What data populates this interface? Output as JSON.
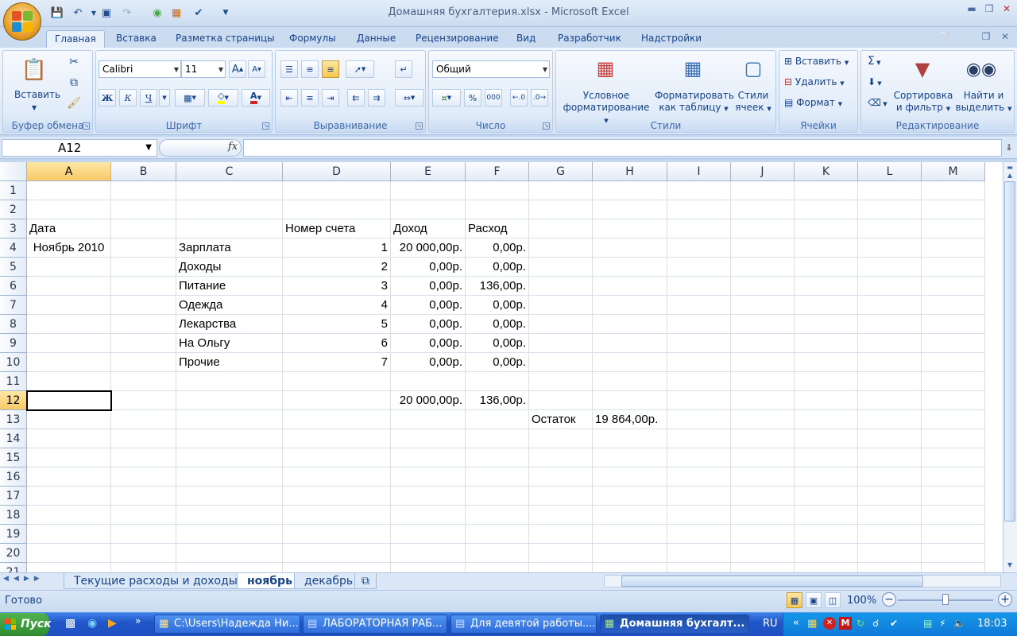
{
  "window": {
    "title": "Домашняя бухгалтерия.xlsx - Microsoft Excel"
  },
  "ribbon": {
    "tabs": [
      "Главная",
      "Вставка",
      "Разметка страницы",
      "Формулы",
      "Данные",
      "Рецензирование",
      "Вид",
      "Разработчик",
      "Надстройки"
    ],
    "active_tab": "Главная",
    "groups": {
      "clipboard": {
        "label": "Буфер обмена",
        "paste": "Вставить"
      },
      "font": {
        "label": "Шрифт",
        "font_name": "Calibri",
        "font_size": "11",
        "bold": "Ж",
        "italic": "К",
        "underline": "Ч",
        "grow": "A",
        "shrink": "A",
        "font_color_letter": "A"
      },
      "alignment": {
        "label": "Выравнивание"
      },
      "number": {
        "label": "Число",
        "format": "Общий",
        "percent": "%",
        "thousands": "000"
      },
      "styles": {
        "label": "Стили",
        "conditional": "Условное",
        "conditional2": "форматирование",
        "table": "Форматировать",
        "table2": "как таблицу",
        "cell_styles": "Стили",
        "cell_styles2": "ячеек"
      },
      "cells": {
        "label": "Ячейки",
        "insert": "Вставить",
        "delete": "Удалить",
        "format": "Формат"
      },
      "editing": {
        "label": "Редактирование",
        "sort": "Сортировка",
        "sort2": "и фильтр",
        "find": "Найти и",
        "find2": "выделить",
        "sigma": "Σ"
      }
    }
  },
  "formula_bar": {
    "name_box": "A12",
    "fx": "fx",
    "value": ""
  },
  "grid": {
    "columns": [
      "A",
      "B",
      "C",
      "D",
      "E",
      "F",
      "G",
      "H",
      "I",
      "J",
      "K",
      "L",
      "M"
    ],
    "rows": [
      "1",
      "2",
      "3",
      "4",
      "5",
      "6",
      "7",
      "8",
      "9",
      "10",
      "11",
      "12",
      "13",
      "14",
      "15",
      "16",
      "17",
      "18",
      "19",
      "20",
      "21"
    ],
    "selected_col": "A",
    "selected_row": "12",
    "cells": [
      {
        "ref": "A3",
        "col": 0,
        "row": 2,
        "v": "Дата",
        "align": "l"
      },
      {
        "ref": "D3",
        "col": 3,
        "row": 2,
        "v": "Номер счета",
        "align": "l"
      },
      {
        "ref": "E3",
        "col": 4,
        "row": 2,
        "v": "Доход",
        "align": "l"
      },
      {
        "ref": "F3",
        "col": 5,
        "row": 2,
        "v": "Расход",
        "align": "l"
      },
      {
        "ref": "A4",
        "col": 0,
        "row": 3,
        "v": "Ноябрь 2010",
        "align": "c"
      },
      {
        "ref": "C4",
        "col": 2,
        "row": 3,
        "v": "Зарплата",
        "align": "l"
      },
      {
        "ref": "D4",
        "col": 3,
        "row": 3,
        "v": "1",
        "align": "r"
      },
      {
        "ref": "E4",
        "col": 4,
        "row": 3,
        "v": "20 000,00р.",
        "align": "r"
      },
      {
        "ref": "F4",
        "col": 5,
        "row": 3,
        "v": "0,00р.",
        "align": "r"
      },
      {
        "ref": "C5",
        "col": 2,
        "row": 4,
        "v": "Доходы",
        "align": "l"
      },
      {
        "ref": "D5",
        "col": 3,
        "row": 4,
        "v": "2",
        "align": "r"
      },
      {
        "ref": "E5",
        "col": 4,
        "row": 4,
        "v": "0,00р.",
        "align": "r"
      },
      {
        "ref": "F5",
        "col": 5,
        "row": 4,
        "v": "0,00р.",
        "align": "r"
      },
      {
        "ref": "C6",
        "col": 2,
        "row": 5,
        "v": "Питание",
        "align": "l"
      },
      {
        "ref": "D6",
        "col": 3,
        "row": 5,
        "v": "3",
        "align": "r"
      },
      {
        "ref": "E6",
        "col": 4,
        "row": 5,
        "v": "0,00р.",
        "align": "r"
      },
      {
        "ref": "F6",
        "col": 5,
        "row": 5,
        "v": "136,00р.",
        "align": "r"
      },
      {
        "ref": "C7",
        "col": 2,
        "row": 6,
        "v": "Одежда",
        "align": "l"
      },
      {
        "ref": "D7",
        "col": 3,
        "row": 6,
        "v": "4",
        "align": "r"
      },
      {
        "ref": "E7",
        "col": 4,
        "row": 6,
        "v": "0,00р.",
        "align": "r"
      },
      {
        "ref": "F7",
        "col": 5,
        "row": 6,
        "v": "0,00р.",
        "align": "r"
      },
      {
        "ref": "C8",
        "col": 2,
        "row": 7,
        "v": "Лекарства",
        "align": "l"
      },
      {
        "ref": "D8",
        "col": 3,
        "row": 7,
        "v": "5",
        "align": "r"
      },
      {
        "ref": "E8",
        "col": 4,
        "row": 7,
        "v": "0,00р.",
        "align": "r"
      },
      {
        "ref": "F8",
        "col": 5,
        "row": 7,
        "v": "0,00р.",
        "align": "r"
      },
      {
        "ref": "C9",
        "col": 2,
        "row": 8,
        "v": "На Ольгу",
        "align": "l"
      },
      {
        "ref": "D9",
        "col": 3,
        "row": 8,
        "v": "6",
        "align": "r"
      },
      {
        "ref": "E9",
        "col": 4,
        "row": 8,
        "v": "0,00р.",
        "align": "r"
      },
      {
        "ref": "F9",
        "col": 5,
        "row": 8,
        "v": "0,00р.",
        "align": "r"
      },
      {
        "ref": "C10",
        "col": 2,
        "row": 9,
        "v": "Прочие",
        "align": "l"
      },
      {
        "ref": "D10",
        "col": 3,
        "row": 9,
        "v": "7",
        "align": "r"
      },
      {
        "ref": "E10",
        "col": 4,
        "row": 9,
        "v": "0,00р.",
        "align": "r"
      },
      {
        "ref": "F10",
        "col": 5,
        "row": 9,
        "v": "0,00р.",
        "align": "r"
      },
      {
        "ref": "E12",
        "col": 4,
        "row": 11,
        "v": "20 000,00р.",
        "align": "r"
      },
      {
        "ref": "F12",
        "col": 5,
        "row": 11,
        "v": "136,00р.",
        "align": "r"
      },
      {
        "ref": "G13",
        "col": 6,
        "row": 12,
        "v": "Остаток",
        "align": "l"
      },
      {
        "ref": "H13",
        "col": 7,
        "row": 12,
        "v": "19 864,00р.",
        "align": "l"
      }
    ]
  },
  "sheets": {
    "tabs": [
      "Текущие расходы и доходы",
      "ноябрь",
      "декабрь"
    ],
    "active": "ноябрь"
  },
  "status": {
    "ready": "Готово",
    "zoom": "100%"
  },
  "taskbar": {
    "start": "Пуск",
    "tasks": [
      {
        "label": "C:\\Users\\Надежда Ни...",
        "active": false
      },
      {
        "label": "ЛАБОРАТОРНАЯ РАБ...",
        "active": false
      },
      {
        "label": "Для девятой работы....",
        "active": false
      },
      {
        "label": "Домашняя бухгалт...",
        "active": true
      }
    ],
    "lang": "RU",
    "clock": "18:03"
  },
  "colors": {
    "accent": "#15428b",
    "selection": "#f7c866",
    "taskbar": "#2256c9"
  }
}
